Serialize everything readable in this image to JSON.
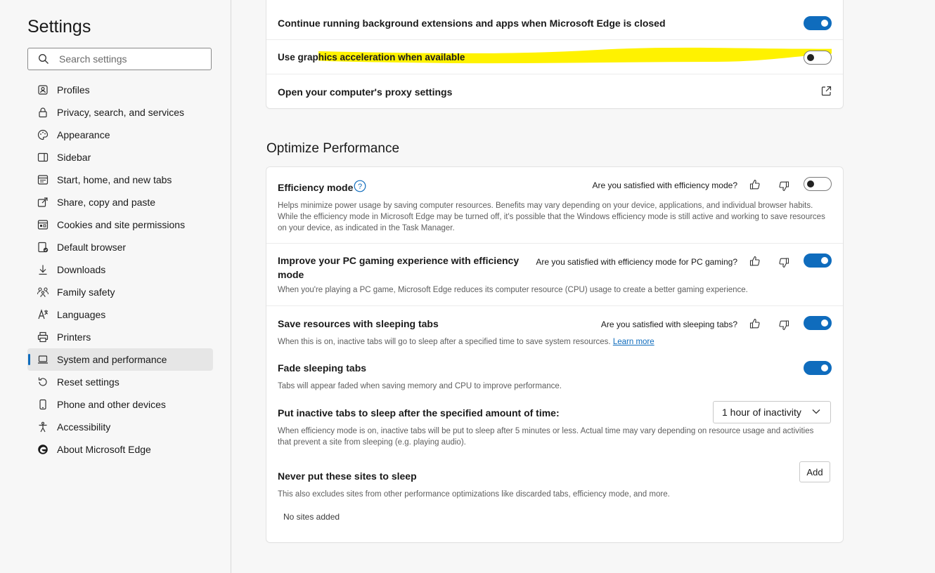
{
  "sidebar": {
    "title": "Settings",
    "search_placeholder": "Search settings",
    "items": [
      {
        "label": "Profiles",
        "icon": "profile-icon"
      },
      {
        "label": "Privacy, search, and services",
        "icon": "lock-icon"
      },
      {
        "label": "Appearance",
        "icon": "palette-icon"
      },
      {
        "label": "Sidebar",
        "icon": "sidebar-icon"
      },
      {
        "label": "Start, home, and new tabs",
        "icon": "home-tab-icon"
      },
      {
        "label": "Share, copy and paste",
        "icon": "share-icon"
      },
      {
        "label": "Cookies and site permissions",
        "icon": "cookie-icon"
      },
      {
        "label": "Default browser",
        "icon": "browser-icon"
      },
      {
        "label": "Downloads",
        "icon": "download-icon"
      },
      {
        "label": "Family safety",
        "icon": "family-icon"
      },
      {
        "label": "Languages",
        "icon": "language-icon"
      },
      {
        "label": "Printers",
        "icon": "printer-icon"
      },
      {
        "label": "System and performance",
        "icon": "laptop-icon",
        "active": true
      },
      {
        "label": "Reset settings",
        "icon": "reset-icon"
      },
      {
        "label": "Phone and other devices",
        "icon": "phone-icon"
      },
      {
        "label": "Accessibility",
        "icon": "accessibility-icon"
      },
      {
        "label": "About Microsoft Edge",
        "icon": "edge-logo-icon"
      }
    ]
  },
  "system_card": {
    "background_apps": {
      "label": "Continue running background extensions and apps when Microsoft Edge is closed",
      "enabled": true
    },
    "graphics_acceleration": {
      "label": "Use graphics acceleration when available",
      "enabled": false
    },
    "proxy": {
      "label": "Open your computer's proxy settings"
    }
  },
  "performance": {
    "section_title": "Optimize Performance",
    "efficiency_mode": {
      "title": "Efficiency mode",
      "question": "Are you satisfied with efficiency mode?",
      "description": "Helps minimize power usage by saving computer resources. Benefits may vary depending on your device, applications, and individual browser habits. While the efficiency mode in Microsoft Edge may be turned off, it's possible that the Windows efficiency mode is still active and working to save resources on your device, as indicated in the Task Manager.",
      "enabled": false
    },
    "gaming": {
      "title": "Improve your PC gaming experience with efficiency mode",
      "question": "Are you satisfied with efficiency mode for PC gaming?",
      "description": "When you're playing a PC game, Microsoft Edge reduces its computer resource (CPU) usage to create a better gaming experience.",
      "enabled": true
    },
    "sleeping_tabs": {
      "title": "Save resources with sleeping tabs",
      "question": "Are you satisfied with sleeping tabs?",
      "description": "When this is on, inactive tabs will go to sleep after a specified time to save system resources.",
      "learn_more": "Learn more",
      "enabled": true
    },
    "fade_tabs": {
      "title": "Fade sleeping tabs",
      "description": "Tabs will appear faded when saving memory and CPU to improve performance.",
      "enabled": true
    },
    "inactive_sleep": {
      "title": "Put inactive tabs to sleep after the specified amount of time:",
      "selected": "1 hour of inactivity",
      "description": "When efficiency mode is on, inactive tabs will be put to sleep after 5 minutes or less. Actual time may vary depending on resource usage and activities that prevent a site from sleeping (e.g. playing audio)."
    },
    "never_sleep": {
      "title": "Never put these sites to sleep",
      "add_label": "Add",
      "description": "This also excludes sites from other performance optimizations like discarded tabs, efficiency mode, and more.",
      "empty_text": "No sites added"
    }
  },
  "colors": {
    "accent": "#0f6cbd",
    "highlight": "#fff200"
  }
}
